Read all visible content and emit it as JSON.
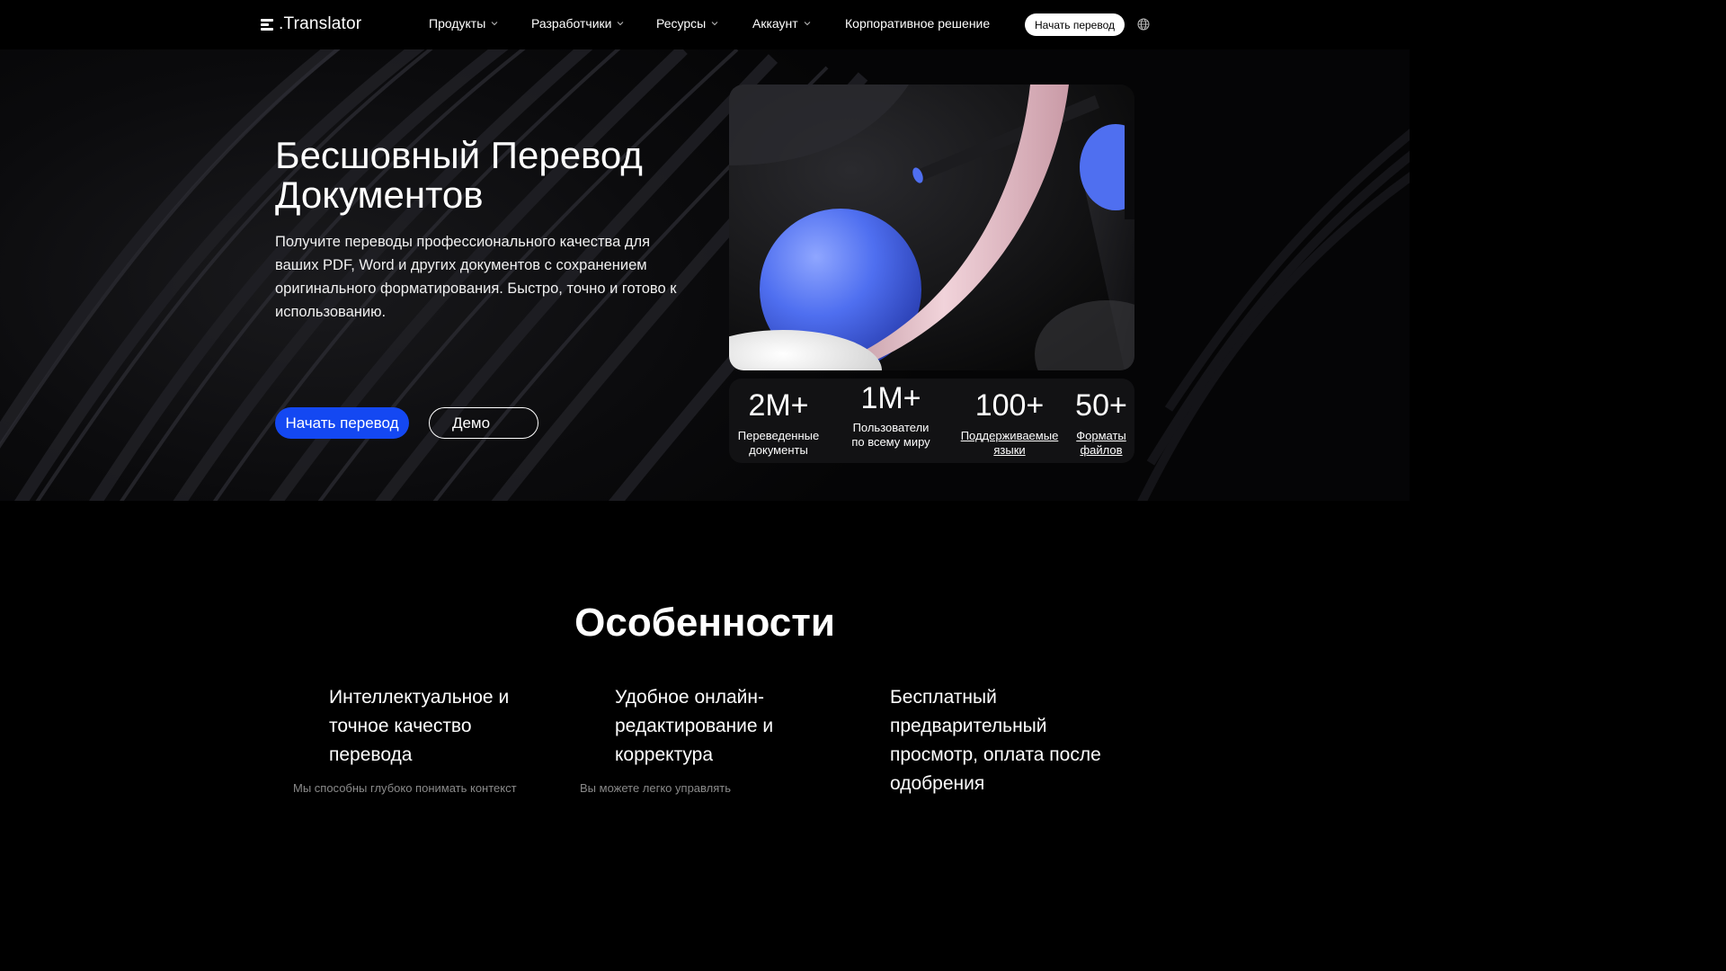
{
  "nav": {
    "logo_text": ".Translator",
    "items": [
      {
        "label": "Продукты"
      },
      {
        "label": "Разработчики"
      },
      {
        "label": "Ресурсы"
      },
      {
        "label": "Аккаунт"
      },
      {
        "label": "Корпоративное решение"
      }
    ],
    "cta_label": "Начать перевод",
    "language_icon": "globe-icon"
  },
  "hero": {
    "title": "Бесшовный Перевод Документов",
    "description": "Получите переводы профессионального качества для ваших PDF, Word и других документов с сохранением оригинального форматирования. Быстро, точно и готово к использованию.",
    "primary_button": "Начать перевод",
    "secondary_button": "Демо"
  },
  "stats": [
    {
      "value": "2M+",
      "label": "Переведенные документы"
    },
    {
      "value": "1M+",
      "label": "Пользователи по всему миру"
    },
    {
      "value": "100+",
      "label": "Поддерживаемые языки"
    },
    {
      "value": "50+",
      "label": "Форматы файлов"
    }
  ],
  "features": {
    "title": "Особенности",
    "items": [
      {
        "title": "Интеллектуальное и точное качество перевода",
        "description": "Мы способны глубоко понимать контекст"
      },
      {
        "title": "Удобное онлайн-редактирование и корректура",
        "description": "Вы можете легко управлять"
      },
      {
        "title": "Бесплатный предварительный просмотр, оплата после одобрения",
        "description": ""
      }
    ]
  },
  "colors": {
    "accent": "#1448f2",
    "background": "#000000",
    "sphere": "#4f6ff0",
    "ribbon": "#e8c6cf"
  }
}
